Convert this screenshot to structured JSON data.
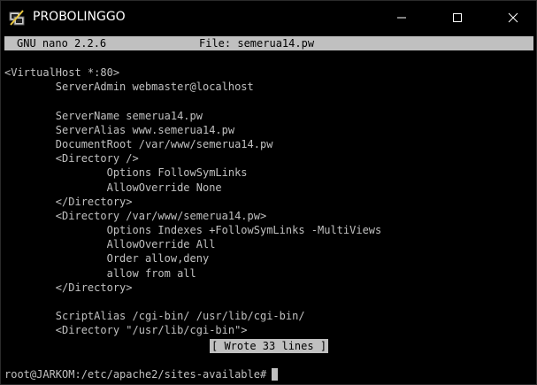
{
  "window": {
    "title": "PROBOLINGGO",
    "icon": "putty-icon",
    "controls": [
      "minimize-icon",
      "maximize-icon",
      "close-icon"
    ]
  },
  "nano": {
    "version": "GNU nano 2.2.6",
    "file_label": "File: semerua14.pw"
  },
  "file_lines": [
    "<VirtualHost *:80>",
    "        ServerAdmin webmaster@localhost",
    "",
    "        ServerName semerua14.pw",
    "        ServerAlias www.semerua14.pw",
    "        DocumentRoot /var/www/semerua14.pw",
    "        <Directory />",
    "                Options FollowSymLinks",
    "                AllowOverride None",
    "        </Directory>",
    "        <Directory /var/www/semerua14.pw>",
    "                Options Indexes +FollowSymLinks -MultiViews",
    "                AllowOverride All",
    "                Order allow,deny",
    "                allow from all",
    "        </Directory>",
    "",
    "        ScriptAlias /cgi-bin/ /usr/lib/cgi-bin/",
    "        <Directory \"/usr/lib/cgi-bin\">"
  ],
  "status": {
    "message": "[ Wrote 33 lines ]"
  },
  "shell": {
    "prompt": "root@JARKOM:/etc/apache2/sites-available#"
  },
  "colors": {
    "background": "#000000",
    "foreground": "#c0c0c0",
    "title_text": "#ffffff"
  }
}
